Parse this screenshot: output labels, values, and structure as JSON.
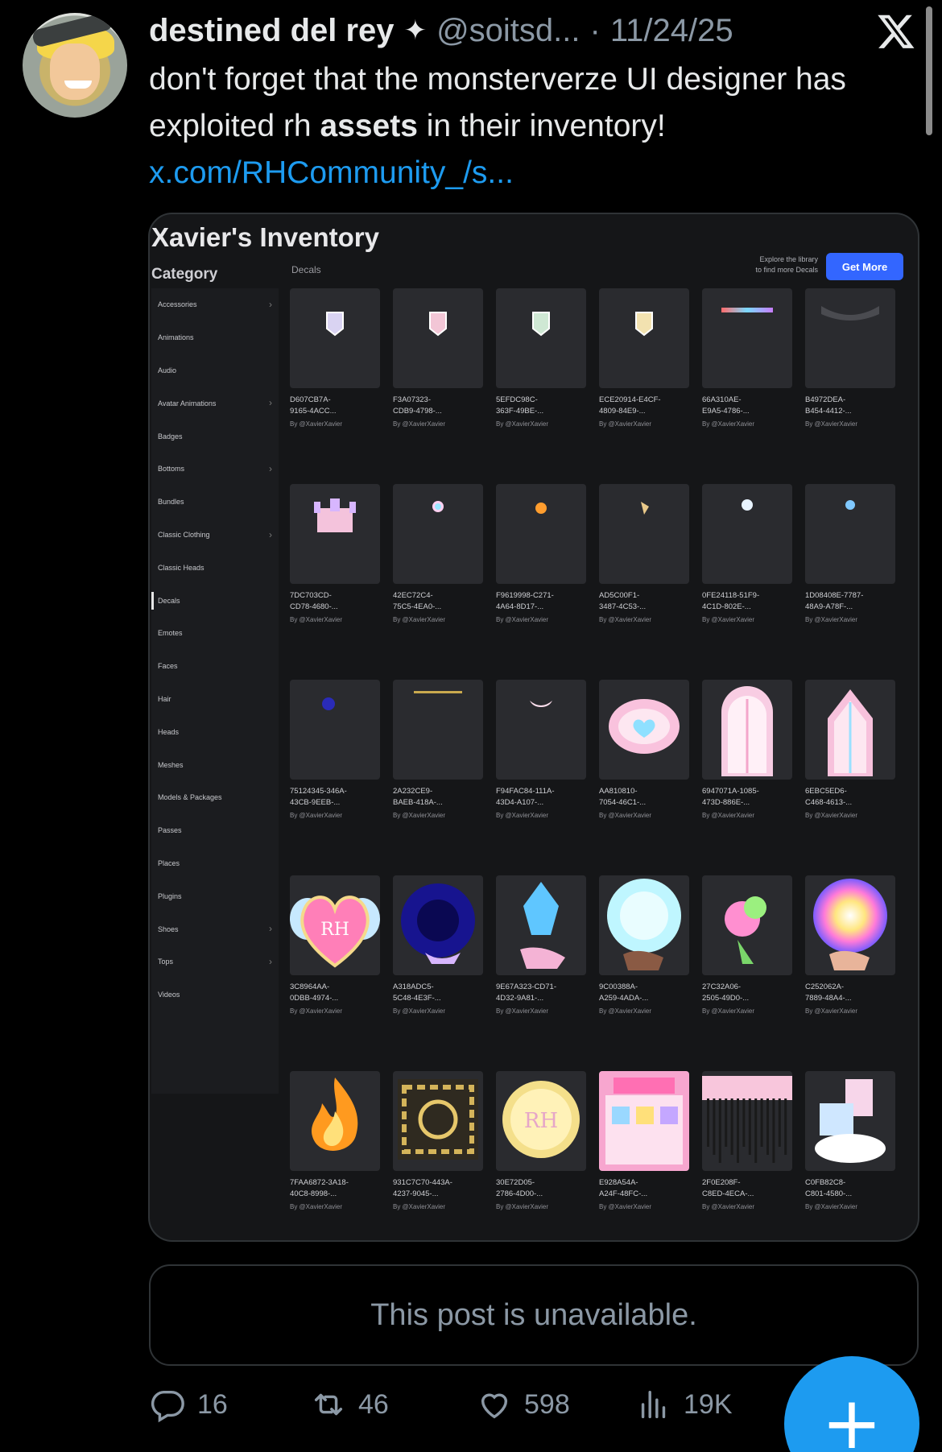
{
  "tweet": {
    "author_name": "destined del rey",
    "verified_glyph": "✦",
    "handle": "@soitsd...",
    "separator": "·",
    "date": "11/24/25",
    "text_part1": "don't forget that the monsterverze UI designer has exploited rh ",
    "text_bold": "assets",
    "text_part2": " in their inventory!",
    "link": "x.com/RHCommunity_/s...",
    "quoted_unavailable": "This post is unavailable."
  },
  "inventory": {
    "title": "Xavier's Inventory",
    "category_label": "Category",
    "section_label": "Decals",
    "explore_text_1": "Explore the library",
    "explore_text_2": "to find more Decals",
    "get_more_label": "Get More",
    "categories": [
      {
        "label": "Accessories",
        "chevron": true
      },
      {
        "label": "Animations",
        "chevron": false
      },
      {
        "label": "Audio",
        "chevron": false
      },
      {
        "label": "Avatar Animations",
        "chevron": true
      },
      {
        "label": "Badges",
        "chevron": false
      },
      {
        "label": "Bottoms",
        "chevron": true
      },
      {
        "label": "Bundles",
        "chevron": false
      },
      {
        "label": "Classic Clothing",
        "chevron": true
      },
      {
        "label": "Classic Heads",
        "chevron": false
      },
      {
        "label": "Decals",
        "chevron": false,
        "active": true
      },
      {
        "label": "Emotes",
        "chevron": false
      },
      {
        "label": "Faces",
        "chevron": false
      },
      {
        "label": "Hair",
        "chevron": false
      },
      {
        "label": "Heads",
        "chevron": false
      },
      {
        "label": "Meshes",
        "chevron": false
      },
      {
        "label": "Models & Packages",
        "chevron": false
      },
      {
        "label": "Passes",
        "chevron": false
      },
      {
        "label": "Places",
        "chevron": false
      },
      {
        "label": "Plugins",
        "chevron": false
      },
      {
        "label": "Shoes",
        "chevron": true
      },
      {
        "label": "Tops",
        "chevron": true
      },
      {
        "label": "Videos",
        "chevron": false
      }
    ],
    "creator_line": "By @XavierXavier",
    "items": [
      {
        "id1": "D607CB7A-",
        "id2": "9165-4ACC...",
        "art": "banner-purple"
      },
      {
        "id1": "F3A07323-",
        "id2": "CDB9-4798-...",
        "art": "banner-pink"
      },
      {
        "id1": "5EFDC98C-",
        "id2": "363F-49BE-...",
        "art": "banner-green"
      },
      {
        "id1": "ECE20914-E4CF-",
        "id2": "4809-84E9-...",
        "art": "banner-gold"
      },
      {
        "id1": "66A310AE-",
        "id2": "E9A5-4786-...",
        "art": "strip-rainbow"
      },
      {
        "id1": "B4972DEA-",
        "id2": "B454-4412-...",
        "art": "lace-grey"
      },
      {
        "id1": "7DC703CD-",
        "id2": "CD78-4680-...",
        "art": "castle-pink"
      },
      {
        "id1": "42EC72C4-",
        "id2": "75C5-4EA0-...",
        "art": "dot-rainbow"
      },
      {
        "id1": "F9619998-C271-",
        "id2": "4A64-8D17-...",
        "art": "dot-orange"
      },
      {
        "id1": "AD5C00F1-",
        "id2": "3487-4C53-...",
        "art": "dot-gold"
      },
      {
        "id1": "0FE24118-51F9-",
        "id2": "4C1D-802E-...",
        "art": "dot-white"
      },
      {
        "id1": "1D08408E-7787-",
        "id2": "48A9-A78F-...",
        "art": "dot-blue"
      },
      {
        "id1": "75124345-346A-",
        "id2": "43CB-9EEB-...",
        "art": "dot-navy"
      },
      {
        "id1": "2A232CE9-",
        "id2": "BAEB-418A-...",
        "art": "line-gold"
      },
      {
        "id1": "F94FAC84-111A-",
        "id2": "43D4-A107-...",
        "art": "bow-pink"
      },
      {
        "id1": "AA810810-",
        "id2": "7054-46C1-...",
        "art": "oval-heart"
      },
      {
        "id1": "6947071A-1085-",
        "id2": "473D-886E-...",
        "art": "window-pink"
      },
      {
        "id1": "6EBC5ED6-",
        "id2": "C468-4613-...",
        "art": "window-pink2"
      },
      {
        "id1": "3C8964AA-",
        "id2": "0DBB-4974-...",
        "art": "heart-rh"
      },
      {
        "id1": "A318ADC5-",
        "id2": "5C48-4E3F-...",
        "art": "orb-navy"
      },
      {
        "id1": "9E67A323-CD71-",
        "id2": "4D32-9A81-...",
        "art": "crystal-blue"
      },
      {
        "id1": "9C00388A-",
        "id2": "A259-4ADA-...",
        "art": "orb-glow"
      },
      {
        "id1": "27C32A06-",
        "id2": "2505-49D0-...",
        "art": "bouquet"
      },
      {
        "id1": "C252062A-",
        "id2": "7889-48A4-...",
        "art": "orb-rainbow"
      },
      {
        "id1": "7FAA6872-3A18-",
        "id2": "40C8-8998-...",
        "art": "flame"
      },
      {
        "id1": "931C7C70-443A-",
        "id2": "4237-9045-...",
        "art": "ornament-gold"
      },
      {
        "id1": "30E72D05-",
        "id2": "2786-4D00-...",
        "art": "plate-rh"
      },
      {
        "id1": "E928A54A-",
        "id2": "A24F-48FC-...",
        "art": "art-board"
      },
      {
        "id1": "2F0E208F-",
        "id2": "C8ED-4ECA-...",
        "art": "fringe-pink"
      },
      {
        "id1": "C0FB82C8-",
        "id2": "C801-4580-...",
        "art": "cloud-stack"
      }
    ]
  },
  "actions": {
    "replies": "16",
    "reposts": "46",
    "likes": "598",
    "views": "19K",
    "compose_glyph": "+"
  },
  "colors": {
    "link": "#1d9bf0",
    "muted": "#8b98a5",
    "accent_button": "#3366ff"
  }
}
